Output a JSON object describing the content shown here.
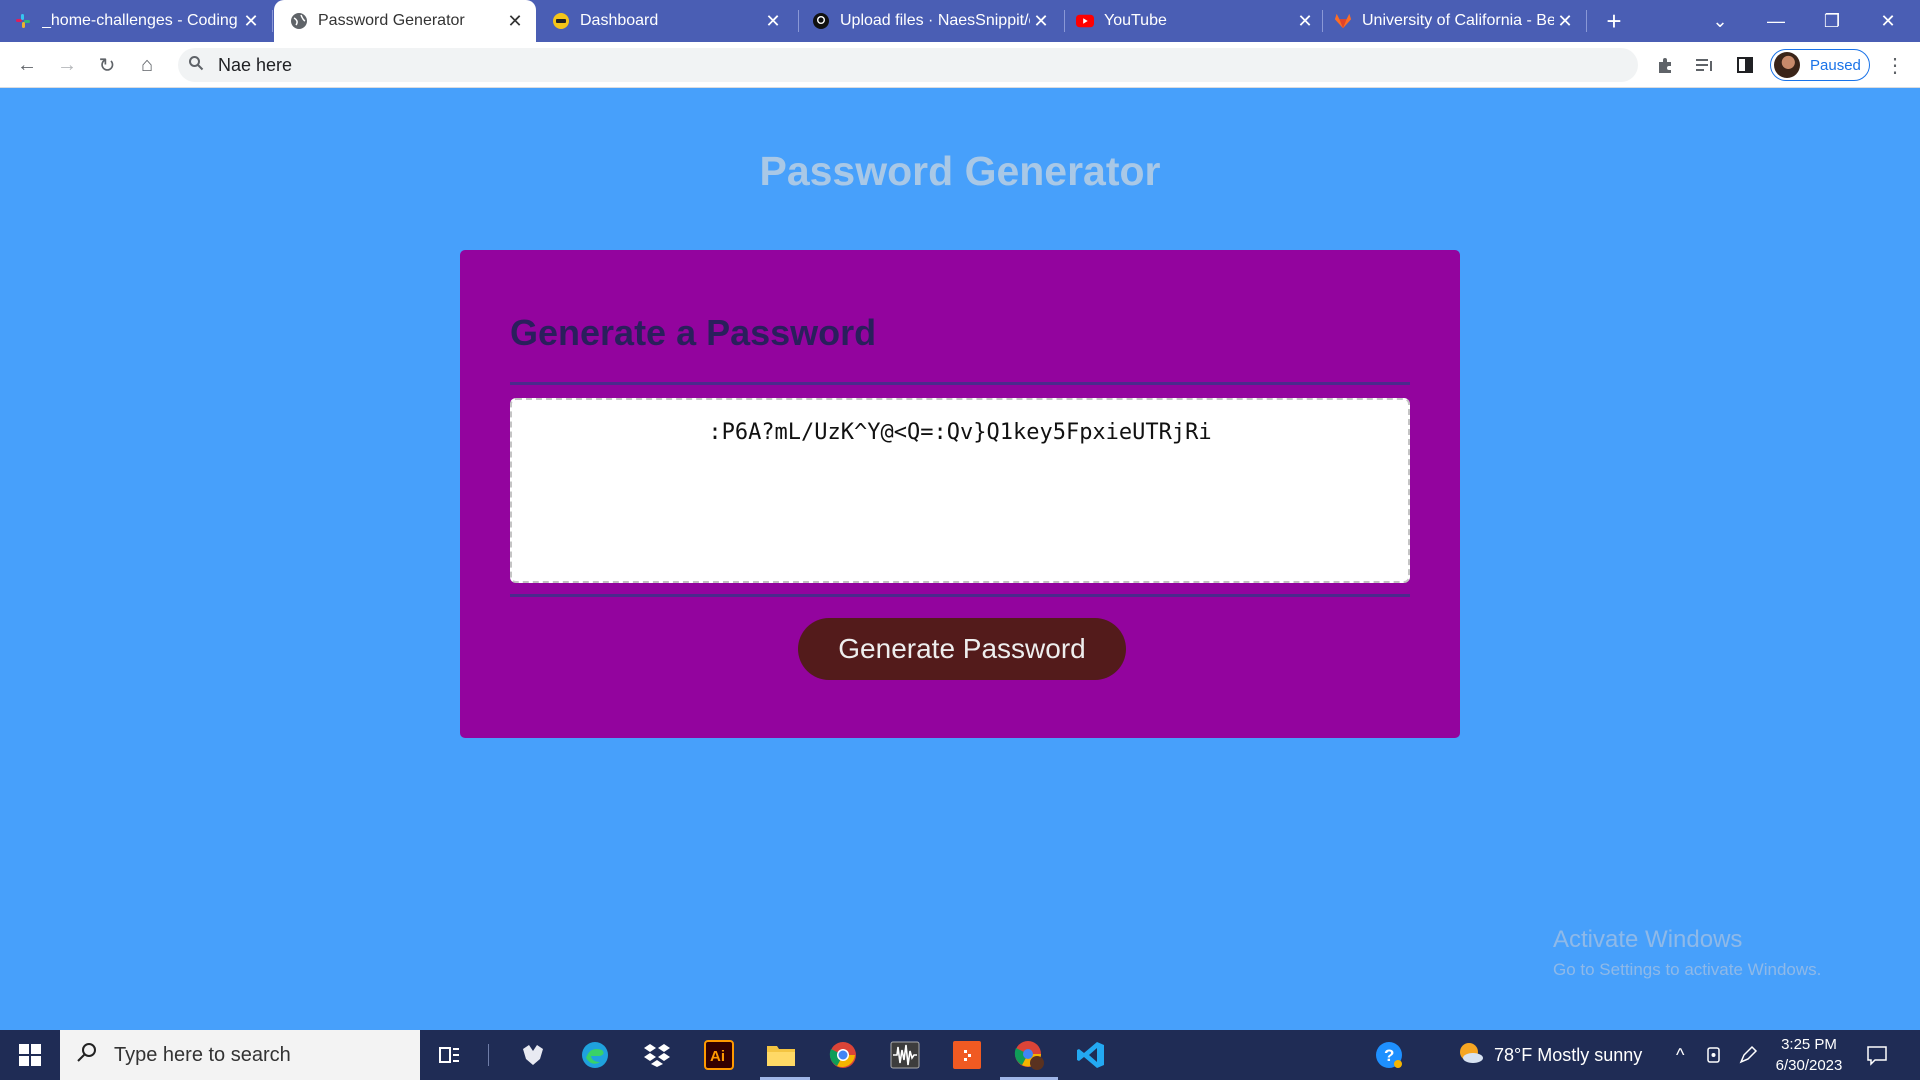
{
  "browser": {
    "tabs": [
      {
        "title": "_home-challenges - Coding",
        "favicon": "slack-icon",
        "active": false
      },
      {
        "title": "Password Generator",
        "favicon": "globe-icon",
        "active": true
      },
      {
        "title": "Dashboard",
        "favicon": "dashboard-icon",
        "active": false
      },
      {
        "title": "Upload files · NaesSnippit/c",
        "favicon": "github-icon",
        "active": false
      },
      {
        "title": "YouTube",
        "favicon": "youtube-icon",
        "active": false
      },
      {
        "title": "University of California - Be",
        "favicon": "gitlab-icon",
        "active": false
      }
    ],
    "address_bar": "Nae here",
    "profile_status": "Paused"
  },
  "page": {
    "heading": "Password Generator",
    "card_title": "Generate a Password",
    "password": ":P6A?mL/UzK^Y@<Q=:Qv}Q1key5FpxieUTRjRi",
    "generate_button": "Generate Password"
  },
  "watermark": {
    "line1": "Activate Windows",
    "line2": "Go to Settings to activate Windows."
  },
  "taskbar": {
    "search_placeholder": "Type here to search",
    "weather": "78°F  Mostly sunny",
    "time": "3:25 PM",
    "date": "6/30/2023",
    "pinned": [
      "task-view-icon",
      "app-icon",
      "edge-icon",
      "dropbox-icon",
      "illustrator-icon",
      "file-explorer-icon",
      "chrome-icon",
      "audio-editor-icon",
      "app-orange-icon",
      "chrome-profile-icon",
      "vscode-icon"
    ]
  },
  "colors": {
    "page_background": "#47a0fb",
    "card_background": "#93049e",
    "button_background": "#531b1b",
    "heading_color": "#a9c8e6",
    "tabstrip": "#4a5eb4"
  }
}
